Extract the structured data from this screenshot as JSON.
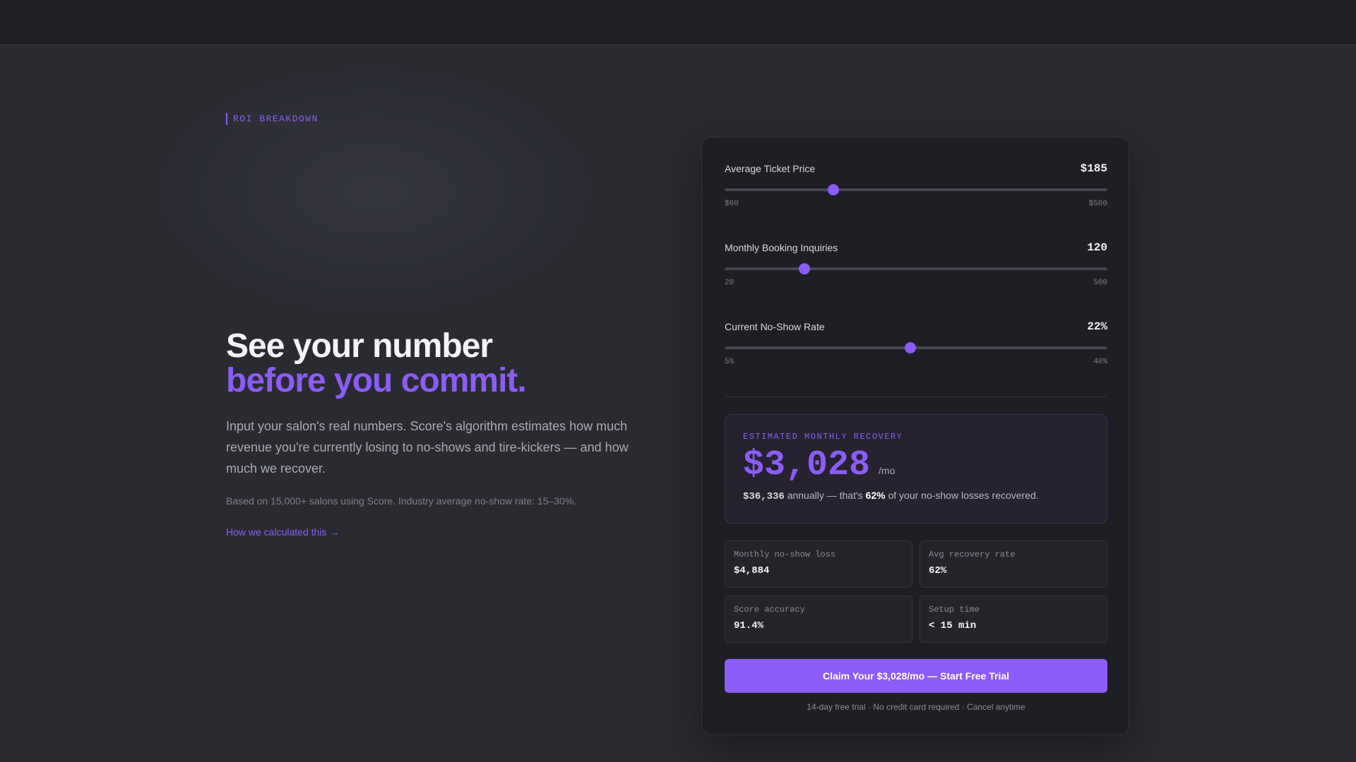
{
  "section": {
    "eyebrow": "ROI BREAKDOWN"
  },
  "hero": {
    "headline_line1": "See your number",
    "headline_line2": "before you commit.",
    "lede": "Input your salon's real numbers. Score's algorithm estimates how much revenue you're currently losing to no-shows and tire-kickers — and how much we recover.",
    "footnote": "Based on 15,000+ salons using Score. Industry average no-show rate: 15–30%.",
    "calc_link": "How we calculated this →"
  },
  "calculator": {
    "sliders": [
      {
        "label": "Average Ticket Price",
        "value_text": "$185",
        "min_text": "$60",
        "max_text": "$500",
        "value": 185,
        "min": 60,
        "max": 500
      },
      {
        "label": "Monthly Booking Inquiries",
        "value_text": "120",
        "min_text": "20",
        "max_text": "500",
        "value": 120,
        "min": 20,
        "max": 500
      },
      {
        "label": "Current No-Show Rate",
        "value_text": "22%",
        "min_text": "5%",
        "max_text": "40%",
        "value": 22,
        "min": 5,
        "max": 40
      }
    ],
    "recovery": {
      "label": "ESTIMATED MONTHLY RECOVERY",
      "amount": "$3,028",
      "unit": "/mo",
      "annual": "$36,336",
      "annual_text": " annually — that's ",
      "pct": "62%",
      "tail": " of your no-show losses recovered."
    },
    "stats": [
      {
        "label": "Monthly no-show loss",
        "value": "$4,884"
      },
      {
        "label": "Avg recovery rate",
        "value": "62%"
      },
      {
        "label": "Score accuracy",
        "value": "91.4%"
      },
      {
        "label": "Setup time",
        "value": "< 15 min"
      }
    ],
    "cta_label": "Claim Your $3,028/mo — Start Free Trial",
    "cta_note": "14-day free trial · No credit card required · Cancel anytime"
  },
  "colors": {
    "accent": "#8b5cf6",
    "background": "#2a2b31",
    "card": "#1e1f24"
  }
}
